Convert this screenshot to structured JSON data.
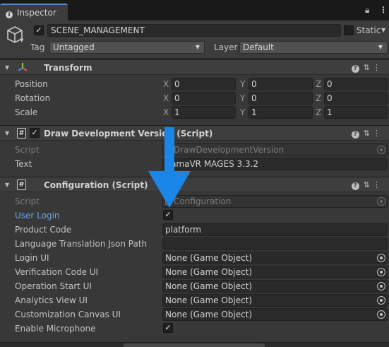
{
  "tab": {
    "label": "Inspector",
    "icons": {
      "lock": "lock-icon",
      "menu": "kebab-menu-icon"
    }
  },
  "object": {
    "name": "SCENE_MANAGEMENT",
    "active": true,
    "static_label": "Static",
    "static_checked": false,
    "tag_label": "Tag",
    "tag_value": "Untagged",
    "layer_label": "Layer",
    "layer_value": "Default"
  },
  "transform": {
    "title": "Transform",
    "rows": [
      {
        "label": "Position",
        "x": "0",
        "y": "0",
        "z": "0"
      },
      {
        "label": "Rotation",
        "x": "0",
        "y": "0",
        "z": "0"
      },
      {
        "label": "Scale",
        "x": "1",
        "y": "1",
        "z": "1"
      }
    ],
    "axes": [
      "X",
      "Y",
      "Z"
    ]
  },
  "draw_dev": {
    "title": "Draw Development Version (Script)",
    "enabled": true,
    "script_label": "Script",
    "script_value": "DrawDevelopmentVersion",
    "text_label": "Text",
    "text_value": "RamaVR MAGES 3.3.2"
  },
  "configuration": {
    "title": "Configuration (Script)",
    "script_label": "Script",
    "script_value": "Configuration",
    "user_login_label": "User Login",
    "user_login_checked": true,
    "product_code_label": "Product Code",
    "product_code_value": "platform",
    "lang_label": "Language Translation Json Path",
    "lang_value": "",
    "object_fields": [
      {
        "label": "Login UI",
        "value": "None (Game Object)"
      },
      {
        "label": "Verification Code UI",
        "value": "None (Game Object)"
      },
      {
        "label": "Operation Start UI",
        "value": "None (Game Object)"
      },
      {
        "label": "Analytics View UI",
        "value": "None (Game Object)"
      },
      {
        "label": "Customization Canvas UI",
        "value": "None (Game Object)"
      }
    ],
    "mic_label": "Enable Microphone",
    "mic_checked": true
  },
  "overlay": {
    "arrow_color": "#1a86e8"
  },
  "colors": {
    "accent": "#4e8cd6",
    "highlight_label": "#6ea3e6"
  }
}
